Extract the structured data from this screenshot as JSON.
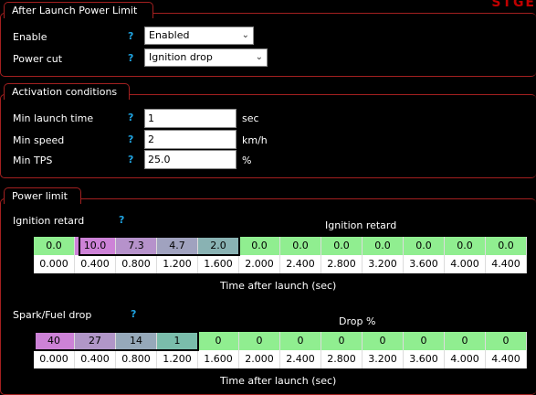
{
  "brand_text": "STGE",
  "after_launch": {
    "title": "After Launch Power Limit",
    "enable_label": "Enable",
    "enable_value": "Enabled",
    "power_cut_label": "Power cut",
    "power_cut_value": "Ignition drop",
    "help": "?"
  },
  "activation": {
    "title": "Activation conditions",
    "min_launch_time_label": "Min launch time",
    "min_launch_time_value": "1",
    "min_launch_time_unit": "sec",
    "min_speed_label": "Min speed",
    "min_speed_value": "2",
    "min_speed_unit": "km/h",
    "min_tps_label": "Min TPS",
    "min_tps_value": "25.0",
    "min_tps_unit": "%"
  },
  "power_limit": {
    "title": "Power limit",
    "ignition_retard": {
      "label": "Ignition retard",
      "table_title": "Ignition retard",
      "values": [
        "0.0",
        "10.0",
        "7.3",
        "4.7",
        "2.0",
        "0.0",
        "0.0",
        "0.0",
        "0.0",
        "0.0",
        "0.0",
        "0.0"
      ],
      "axis": [
        "0.000",
        "0.400",
        "0.800",
        "1.200",
        "1.600",
        "2.000",
        "2.400",
        "2.800",
        "3.200",
        "3.600",
        "4.000",
        "4.400"
      ],
      "axis_title": "Time after launch (sec)"
    },
    "spark_fuel_drop": {
      "label": "Spark/Fuel drop",
      "table_title": "Drop %",
      "values": [
        "40",
        "27",
        "14",
        "1",
        "0",
        "0",
        "0",
        "0",
        "0",
        "0",
        "0",
        "0"
      ],
      "axis": [
        "0.000",
        "0.400",
        "0.800",
        "1.200",
        "1.600",
        "2.000",
        "2.400",
        "2.800",
        "3.200",
        "3.600",
        "4.000",
        "4.400"
      ],
      "axis_title": "Time after launch (sec)"
    }
  },
  "colors": {
    "accent_border": "#a32020",
    "help": "#1fa3e0",
    "zero_cell": "#90ee90"
  }
}
